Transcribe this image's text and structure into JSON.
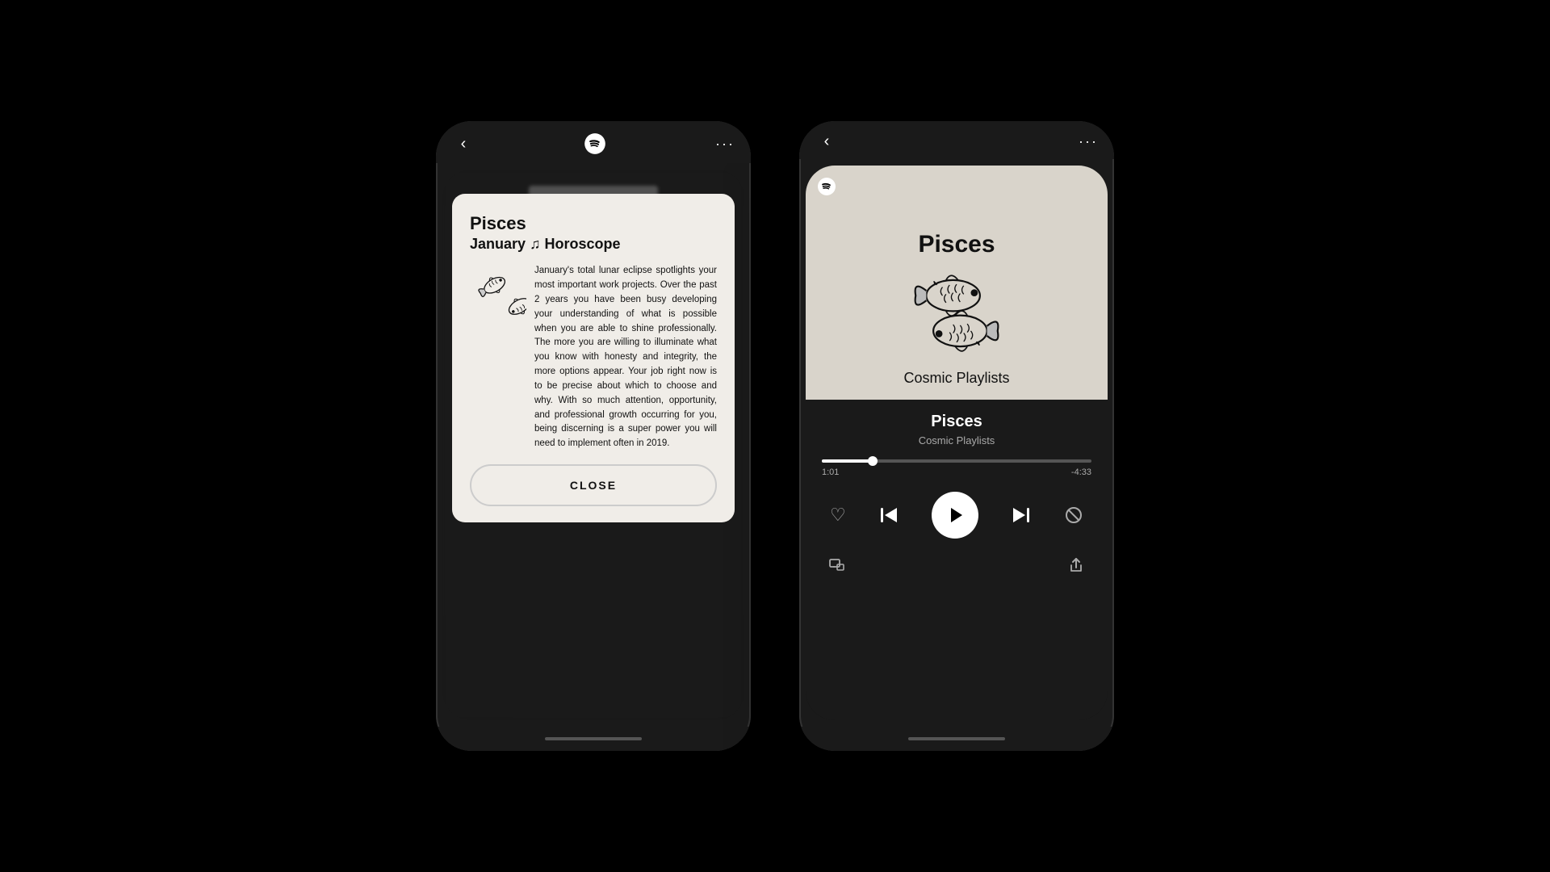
{
  "left_phone": {
    "back_label": "‹",
    "dots_label": "···",
    "modal": {
      "title": "Pisces",
      "subtitle": "January ♫ Horoscope",
      "body": "January's total lunar eclipse spotlights your most important work projects. Over the past 2 years you have been busy developing your understanding of what is possible when you are able to shine professionally. The more you are willing to illuminate what you know with honesty and integrity, the more options appear. Your job right now is to be precise about which to choose and why. With so much attention, opportunity, and professional growth occurring for you, being discerning is a super power you will need to implement often in 2019.",
      "close_label": "CLOSE"
    }
  },
  "right_phone": {
    "back_label": "‹",
    "dots_label": "···",
    "album": {
      "title": "Pisces",
      "subtitle": "Cosmic Playlists"
    },
    "track": {
      "name": "Pisces",
      "album": "Cosmic Playlists"
    },
    "progress": {
      "current": "1:01",
      "remaining": "-4:33",
      "fill_percent": 19
    },
    "controls": {
      "heart": "♡",
      "skip_prev": "⏮",
      "play": "▶",
      "skip_next": "⏭",
      "block": "⊘"
    },
    "bottom": {
      "devices": "⊞",
      "share": "⬆"
    }
  }
}
